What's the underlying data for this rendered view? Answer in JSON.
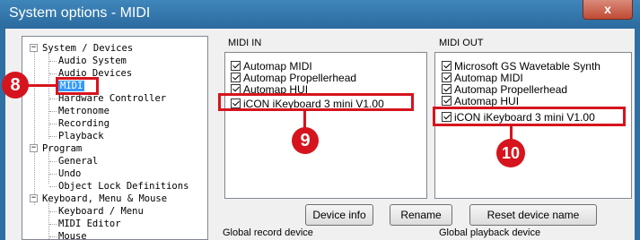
{
  "window": {
    "title": "System options - MIDI",
    "close_glyph": "x"
  },
  "tree": {
    "items": [
      {
        "label": "System / Devices",
        "level": 0,
        "expander": "−"
      },
      {
        "label": "Audio System",
        "level": 1
      },
      {
        "label": "Audio Devices",
        "level": 1
      },
      {
        "label": "MIDI",
        "level": 1,
        "selected": true
      },
      {
        "label": "Hardware Controller",
        "level": 1
      },
      {
        "label": "Metronome",
        "level": 1
      },
      {
        "label": "Recording",
        "level": 1
      },
      {
        "label": "Playback",
        "level": 1
      },
      {
        "label": "Program",
        "level": 0,
        "expander": "−"
      },
      {
        "label": "General",
        "level": 1
      },
      {
        "label": "Undo",
        "level": 1
      },
      {
        "label": "Object Lock Definitions",
        "level": 1
      },
      {
        "label": "Keyboard, Menu & Mouse",
        "level": 0,
        "expander": "−"
      },
      {
        "label": "Keyboard / Menu",
        "level": 1
      },
      {
        "label": "MIDI Editor",
        "level": 1
      },
      {
        "label": "Mouse",
        "level": 1
      }
    ]
  },
  "midi_in": {
    "label": "MIDI IN",
    "items": [
      {
        "label": "Automap MIDI",
        "checked": true
      },
      {
        "label": "Automap Propellerhead",
        "checked": true
      },
      {
        "label": "Automap HUI",
        "checked": true
      },
      {
        "label": "iCON iKeyboard 3 mini V1.00",
        "checked": true
      }
    ]
  },
  "midi_out": {
    "label": "MIDI OUT",
    "items": [
      {
        "label": "Microsoft GS Wavetable Synth",
        "checked": true
      },
      {
        "label": "Automap MIDI",
        "checked": true
      },
      {
        "label": "Automap Propellerhead",
        "checked": true
      },
      {
        "label": "Automap HUI",
        "checked": true
      },
      {
        "label": "iCON iKeyboard 3 mini V1.00",
        "checked": true
      }
    ]
  },
  "buttons": {
    "device_info": "Device info",
    "rename": "Rename",
    "reset_device_name": "Reset device name"
  },
  "footer": {
    "global_record": "Global record device",
    "global_playback": "Global playback device"
  },
  "callouts": {
    "c8": "8",
    "c9": "9",
    "c10": "10"
  },
  "colors": {
    "callout_red": "#d6141d",
    "selection_blue": "#3399ff",
    "title_blue": "#2f6fa3"
  }
}
